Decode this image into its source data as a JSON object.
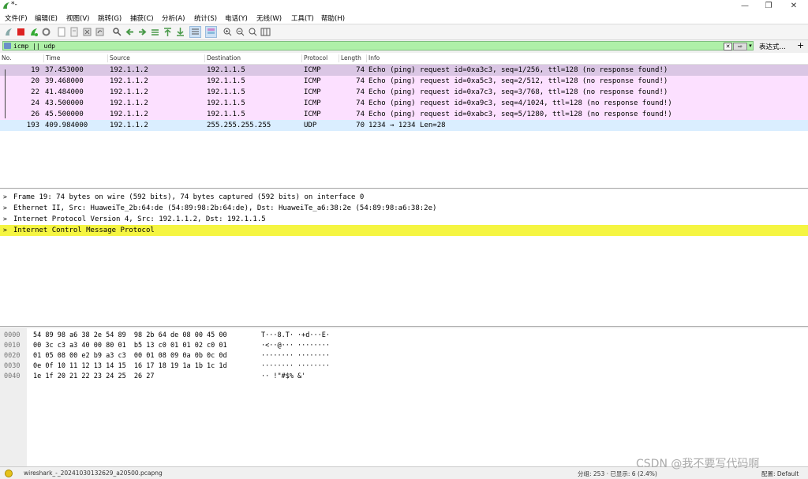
{
  "window": {
    "title": "*-",
    "minimize": "—",
    "maximize": "❐",
    "close": "✕"
  },
  "menu": [
    "文件(F)",
    "编辑(E)",
    "视图(V)",
    "跳转(G)",
    "捕获(C)",
    "分析(A)",
    "统计(S)",
    "电话(Y)",
    "无线(W)",
    "工具(T)",
    "帮助(H)"
  ],
  "toolbar": {
    "icons": [
      "start-capture",
      "stop-capture",
      "restart-capture",
      "capture-options",
      "open-file",
      "save-file",
      "close-file",
      "reload-file",
      "find-packet",
      "go-back",
      "go-forward",
      "go-to-packet",
      "go-first",
      "go-last",
      "auto-scroll",
      "colorize",
      "zoom-in",
      "zoom-out",
      "zoom-normal",
      "resize-columns"
    ]
  },
  "filter": {
    "value": "icmp || udp",
    "expression_label": "表达式…",
    "add_label": "+"
  },
  "packet_list": {
    "columns": [
      "No.",
      "Time",
      "Source",
      "Destination",
      "Protocol",
      "Length",
      "Info"
    ],
    "rows": [
      {
        "no": "19",
        "time": "37.453000",
        "src": "192.1.1.2",
        "dst": "192.1.1.5",
        "proto": "ICMP",
        "len": "74",
        "info": "Echo (ping) request  id=0xa3c3, seq=1/256, ttl=128 (no response found!)",
        "kind": "sel"
      },
      {
        "no": "20",
        "time": "39.468000",
        "src": "192.1.1.2",
        "dst": "192.1.1.5",
        "proto": "ICMP",
        "len": "74",
        "info": "Echo (ping) request  id=0xa5c3, seq=2/512, ttl=128 (no response found!)",
        "kind": "icmp"
      },
      {
        "no": "22",
        "time": "41.484000",
        "src": "192.1.1.2",
        "dst": "192.1.1.5",
        "proto": "ICMP",
        "len": "74",
        "info": "Echo (ping) request  id=0xa7c3, seq=3/768, ttl=128 (no response found!)",
        "kind": "icmp"
      },
      {
        "no": "24",
        "time": "43.500000",
        "src": "192.1.1.2",
        "dst": "192.1.1.5",
        "proto": "ICMP",
        "len": "74",
        "info": "Echo (ping) request  id=0xa9c3, seq=4/1024, ttl=128 (no response found!)",
        "kind": "icmp"
      },
      {
        "no": "26",
        "time": "45.500000",
        "src": "192.1.1.2",
        "dst": "192.1.1.5",
        "proto": "ICMP",
        "len": "74",
        "info": "Echo (ping) request  id=0xabc3, seq=5/1280, ttl=128 (no response found!)",
        "kind": "icmp"
      },
      {
        "no": "193",
        "time": "409.984000",
        "src": "192.1.1.2",
        "dst": "255.255.255.255",
        "proto": "UDP",
        "len": "70",
        "info": "1234 → 1234 Len=28",
        "kind": "udp"
      }
    ]
  },
  "details": [
    "Frame 19: 74 bytes on wire (592 bits), 74 bytes captured (592 bits) on interface 0",
    "Ethernet II, Src: HuaweiTe_2b:64:de (54:89:98:2b:64:de), Dst: HuaweiTe_a6:38:2e (54:89:98:a6:38:2e)",
    "Internet Protocol Version 4, Src: 192.1.1.2, Dst: 192.1.1.5",
    "Internet Control Message Protocol"
  ],
  "hex": [
    {
      "off": "0000",
      "bytes": "54 89 98 a6 38 2e 54 89  98 2b 64 de 08 00 45 00",
      "ascii": "T···8.T· ·+d···E·"
    },
    {
      "off": "0010",
      "bytes": "00 3c c3 a3 40 00 80 01  b5 13 c0 01 01 02 c0 01",
      "ascii": "·<··@··· ········"
    },
    {
      "off": "0020",
      "bytes": "01 05 08 00 e2 b9 a3 c3  00 01 08 09 0a 0b 0c 0d",
      "ascii": "········ ········"
    },
    {
      "off": "0030",
      "bytes": "0e 0f 10 11 12 13 14 15  16 17 18 19 1a 1b 1c 1d",
      "ascii": "········ ········"
    },
    {
      "off": "0040",
      "bytes": "1e 1f 20 21 22 23 24 25  26 27",
      "ascii": "·· !\"#$% &'"
    }
  ],
  "status": {
    "file": "wireshark_-_20241030132629_a20500.pcapng",
    "stats": "分组: 253 · 已显示: 6 (2.4%)",
    "profile": "配置: Default"
  },
  "watermark": "CSDN @我不要写代码啊",
  "colors": {
    "icmp_row": "#fce0ff",
    "selected_row": "#dac6e4",
    "udp_row": "#daeeff",
    "filter_bg": "#aff0a8",
    "highlight": "#f5f542"
  }
}
